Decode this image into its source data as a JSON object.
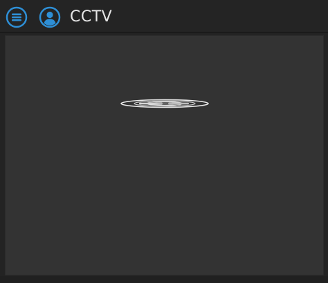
{
  "header": {
    "title": "CCTV",
    "menu_icon": "menu-icon",
    "user_icon": "user-icon",
    "accent_color": "#2e8fd6"
  },
  "viewport": {
    "status_icon": "loading-spinner-icon",
    "background_color": "#333333"
  }
}
